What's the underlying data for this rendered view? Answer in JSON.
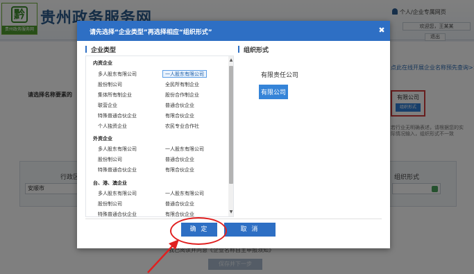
{
  "background": {
    "site_title": "贵州政务服务网",
    "user_menu": "个人/企业专属网页",
    "welcome": "欢迎您，王某某",
    "logout": "退出",
    "logo_band": "贵州政务服务网",
    "name_query_link": "点此在线开展企业名称预先查询>>",
    "select_label": "请选择名称要素的",
    "org_combo_text": "有限公司",
    "org_combo_button": "组织形式",
    "tip_text": "若行业无明确表述，请根据您的实际情况输入，组织形式不一致",
    "region_title": "行政区划",
    "region_value": "安顺市",
    "org_form_title": "组织形式",
    "agreement_text": "我已阅读并同意《企业名称自主申报须知》",
    "next_button": "保存并下一步"
  },
  "dialog": {
    "title": "请先选择“企业类型”再选择相应“组织形式”",
    "close_icon": "close-icon",
    "left_section_title": "企业类型",
    "right_section_title": "组织形式",
    "groups": [
      {
        "title": "内资企业",
        "items": [
          "多人股东有限公司",
          "一人股东有限公司",
          "股份制公司",
          "全民所有制企业",
          "集体所有制企业",
          "股份合作制企业",
          "联营企业",
          "普通合伙企业",
          "特殊普通合伙企业",
          "有限合伙企业",
          "个人独资企业",
          "农民专业合作社"
        ]
      },
      {
        "title": "外资企业",
        "items": [
          "多人股东有限公司",
          "一人股东有限公司",
          "股份制公司",
          "普通合伙企业",
          "特殊普通合伙企业",
          "有限合伙企业"
        ]
      },
      {
        "title": "台、港、澳企业",
        "items": [
          "多人股东有限公司",
          "一人股东有限公司",
          "股份制公司",
          "普通合伙企业",
          "特殊普通合伙企业",
          "有限合伙企业"
        ]
      }
    ],
    "selected_type": "一人股东有限公司",
    "org_forms": [
      "有限责任公司",
      "有限公司"
    ],
    "selected_org_form": "有限公司",
    "confirm_button": "确 定",
    "cancel_button": "取 消"
  },
  "colors": {
    "primary": "#2e6fc4",
    "highlight": "#e02020"
  }
}
